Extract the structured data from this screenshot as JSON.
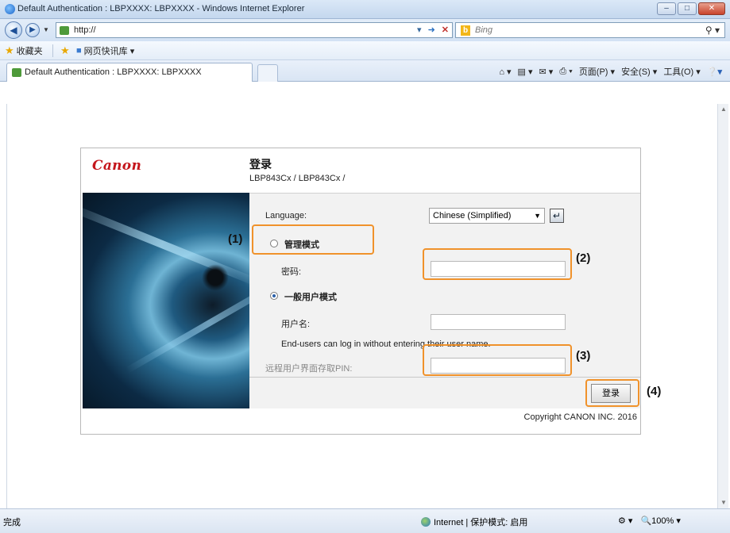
{
  "window": {
    "title": "Default Authentication : LBPXXXX: LBPXXXX - Windows Internet Explorer"
  },
  "address": {
    "url": "http://",
    "search_placeholder": "Bing"
  },
  "favorites": {
    "favorites_label": "收藏夹",
    "webslice_label": "网页快讯库 ▾"
  },
  "tab": {
    "title": "Default Authentication : LBPXXXX: LBPXXXX"
  },
  "command_bar": {
    "page": "页面(P) ▾",
    "safety": "安全(S) ▾",
    "tools": "工具(O) ▾"
  },
  "page": {
    "logo": "Canon",
    "title": "登录",
    "model": "LBP843Cx / LBP843Cx /",
    "language_label": "Language:",
    "language_value": "Chinese (Simplified)",
    "admin_mode_label": "管理模式",
    "password_label": "密码:",
    "general_user_label": "一般用户模式",
    "username_label": "用户名:",
    "enduser_note": "End-users can log in without entering their user name.",
    "remote_pin_label": "远程用户界面存取PIN:",
    "login_button": "登录",
    "copyright": "Copyright CANON INC. 2016"
  },
  "callouts": {
    "c1": "(1)",
    "c2": "(2)",
    "c3": "(3)",
    "c4": "(4)"
  },
  "status": {
    "left": "完成",
    "zone": "Internet | 保护模式: 启用",
    "zoom": "100%"
  },
  "colors": {
    "canon_red": "#c4161c",
    "callout_orange": "#f0922b"
  }
}
